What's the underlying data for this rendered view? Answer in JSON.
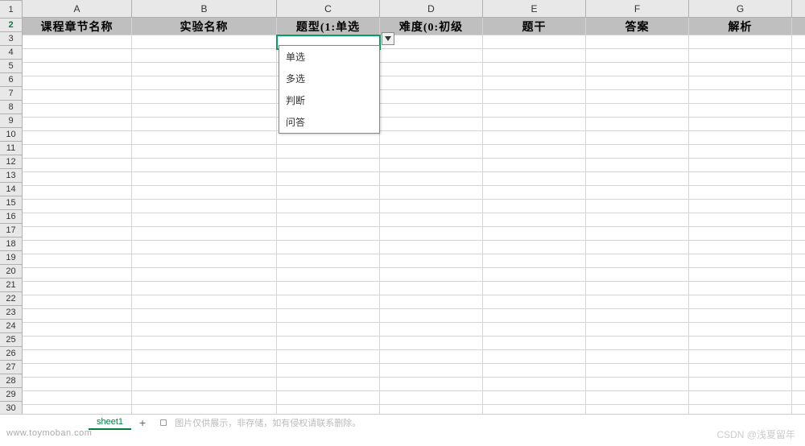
{
  "columns": [
    "A",
    "B",
    "C",
    "D",
    "E",
    "F",
    "G"
  ],
  "row_count": 30,
  "active_cell": {
    "row": 2,
    "col": "C"
  },
  "header_row": {
    "A": "课程章节名称",
    "B": "实验名称",
    "C": "题型(1:单选",
    "D": "难度(0:初级",
    "E": "题干",
    "F": "答案",
    "G": "解析"
  },
  "dropdown": {
    "options": [
      "单选",
      "多选",
      "判断",
      "问答"
    ]
  },
  "sheet": {
    "active_tab": "sheet1",
    "add_label": "+"
  },
  "watermarks": {
    "left": "www.toymoban.com",
    "disclaimer": "图片仅供展示，非存储，如有侵权请联系删除。",
    "right": "CSDN @浅夏留年"
  }
}
